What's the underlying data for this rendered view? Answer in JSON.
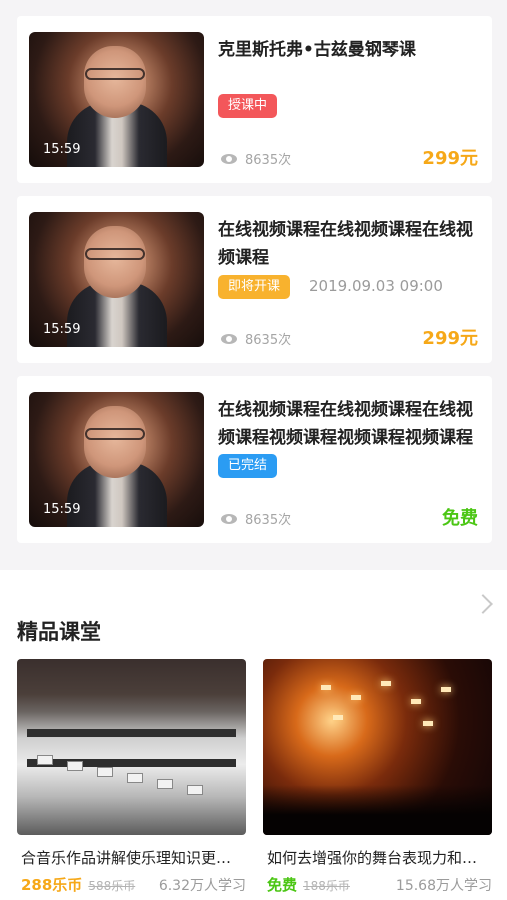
{
  "courses": [
    {
      "title": "克里斯托弗•古兹曼钢琴课",
      "duration": "15:59",
      "badge": "授课中",
      "schedule": "",
      "views": "8635次",
      "price": "299元"
    },
    {
      "title": "在线视频课程在线视频课程在线视频课程",
      "duration": "15:59",
      "badge": "即将开课",
      "schedule": "2019.09.03   09:00",
      "views": "8635次",
      "price": "299元"
    },
    {
      "title": "在线视频课程在线视频课程在线视频课程视频课程视频课程视频课程",
      "duration": "15:59",
      "badge": "已完结",
      "schedule": "",
      "views": "8635次",
      "price": "免费"
    }
  ],
  "featured": {
    "title": "精品课堂",
    "items": [
      {
        "title": "合音乐作品讲解使乐理知识更容易理解",
        "price": "288乐币",
        "original_price": "588乐币",
        "students": "6.32万人学习"
      },
      {
        "title": "如何去增强你的舞台表现力和感染力",
        "price": "免费",
        "original_price": "188乐币",
        "students": "15.68万人学习"
      }
    ]
  },
  "colors": {
    "badge_live": "#f3575a",
    "badge_upcoming": "#f8b22e",
    "badge_finished": "#2b9cf3",
    "price_gold": "#f6a818",
    "price_free": "#4bc614"
  },
  "icons": [
    "eye-icon",
    "chevron-right-icon"
  ]
}
